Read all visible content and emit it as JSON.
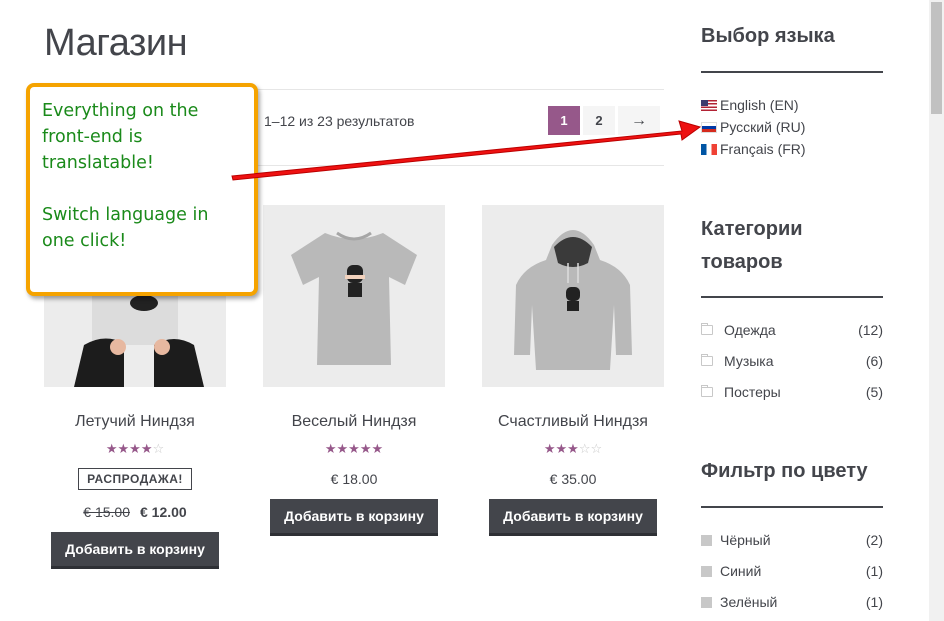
{
  "page": {
    "title": "Магазин"
  },
  "toolbar": {
    "result_count": "1–12 из 23 результатов",
    "pages": [
      "1",
      "2"
    ],
    "next": "→"
  },
  "products": [
    {
      "name": "Летучий Ниндзя",
      "rating": 4,
      "on_sale": true,
      "sale_label": "РАСПРОДАЖА!",
      "old_price": "€ 15.00",
      "price": "€ 12.00",
      "button": "Добавить в корзину"
    },
    {
      "name": "Веселый Ниндзя",
      "rating": 5,
      "on_sale": false,
      "price": "€ 18.00",
      "button": "Добавить в корзину"
    },
    {
      "name": "Счастливый Ниндзя",
      "rating": 3,
      "on_sale": false,
      "price": "€ 35.00",
      "button": "Добавить в корзину"
    }
  ],
  "sidebar": {
    "language": {
      "title": "Выбор языка",
      "items": [
        {
          "label": "English (EN)",
          "flag": "us-flag-icon"
        },
        {
          "label": "Русский (RU)",
          "flag": "ru-flag-icon"
        },
        {
          "label": "Français (FR)",
          "flag": "fr-flag-icon"
        }
      ]
    },
    "categories": {
      "title_line1": "Категории",
      "title_line2": "товаров",
      "items": [
        {
          "label": "Одежда",
          "count": "(12)"
        },
        {
          "label": "Музыка",
          "count": "(6)"
        },
        {
          "label": "Постеры",
          "count": "(5)"
        }
      ]
    },
    "color_filter": {
      "title": "Фильтр по цвету",
      "items": [
        {
          "label": "Чёрный",
          "count": "(2)"
        },
        {
          "label": "Синий",
          "count": "(1)"
        },
        {
          "label": "Зелёный",
          "count": "(1)"
        }
      ]
    }
  },
  "callout": {
    "line1": "Everything on the front-end is translatable!",
    "line2": "Switch language in one click!"
  },
  "colors": {
    "accent": "#96588a",
    "button": "#43454b",
    "callout_border": "#f5a300",
    "callout_text": "#1a8a1a",
    "arrow": "#ee1111"
  }
}
